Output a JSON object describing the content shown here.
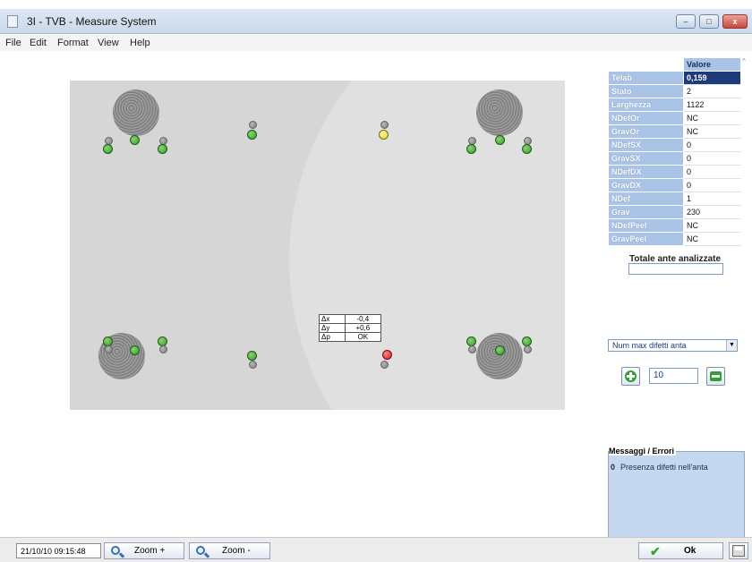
{
  "window": {
    "title": "3I - TVB - Measure System",
    "controls": {
      "minimize": "–",
      "maximize": "□",
      "close": "x"
    }
  },
  "menu": [
    {
      "label": "File"
    },
    {
      "label": "Edit"
    },
    {
      "label": "Format"
    },
    {
      "label": "View"
    },
    {
      "label": "Help"
    }
  ],
  "delta_table": [
    {
      "label": "Δx",
      "value": "-0,4"
    },
    {
      "label": "Δy",
      "value": "+0,6"
    },
    {
      "label": "Δp",
      "value": "OK"
    }
  ],
  "properties": {
    "header": "Valore",
    "rows": [
      {
        "key": "Telab",
        "value": "0,159",
        "selected": true
      },
      {
        "key": "Stato",
        "value": "2"
      },
      {
        "key": "Larghezza",
        "value": "1122"
      },
      {
        "key": "NDefOr",
        "value": "NC"
      },
      {
        "key": "GravOr",
        "value": "NC"
      },
      {
        "key": "NDefSX",
        "value": "0"
      },
      {
        "key": "GravSX",
        "value": "0"
      },
      {
        "key": "NDefDX",
        "value": "0"
      },
      {
        "key": "GravDX",
        "value": "0"
      },
      {
        "key": "NDef",
        "value": "1"
      },
      {
        "key": "Grav",
        "value": "230"
      },
      {
        "key": "NDefPeel",
        "value": "NC"
      },
      {
        "key": "GravPeel",
        "value": "NC"
      }
    ]
  },
  "totale": {
    "label": "Totale ante analizzate",
    "value": ""
  },
  "combo": {
    "selected": "Num max difetti anta"
  },
  "stepper": {
    "value": "10"
  },
  "messages": {
    "caption": "Messaggi / Errori",
    "items": [
      {
        "code": "0",
        "text": "Presenza difetti nell'anta"
      }
    ]
  },
  "statusbar": {
    "datetime": "21/10/10 09:15:48",
    "zoom_in": "Zoom +",
    "zoom_out": "Zoom -",
    "ok": "Ok"
  },
  "colors": {
    "ok": "#3b9a2a",
    "warning": "#e2d12a",
    "defect": "#d41414",
    "selection": "#1f3a78",
    "table_header": "#a9c4e6"
  },
  "icons": {
    "zoom_in": "zoom-in-icon",
    "zoom_out": "zoom-out-icon",
    "plus": "plus-icon",
    "minus": "minus-icon",
    "ok": "check-icon",
    "save": "floppy-icon"
  }
}
